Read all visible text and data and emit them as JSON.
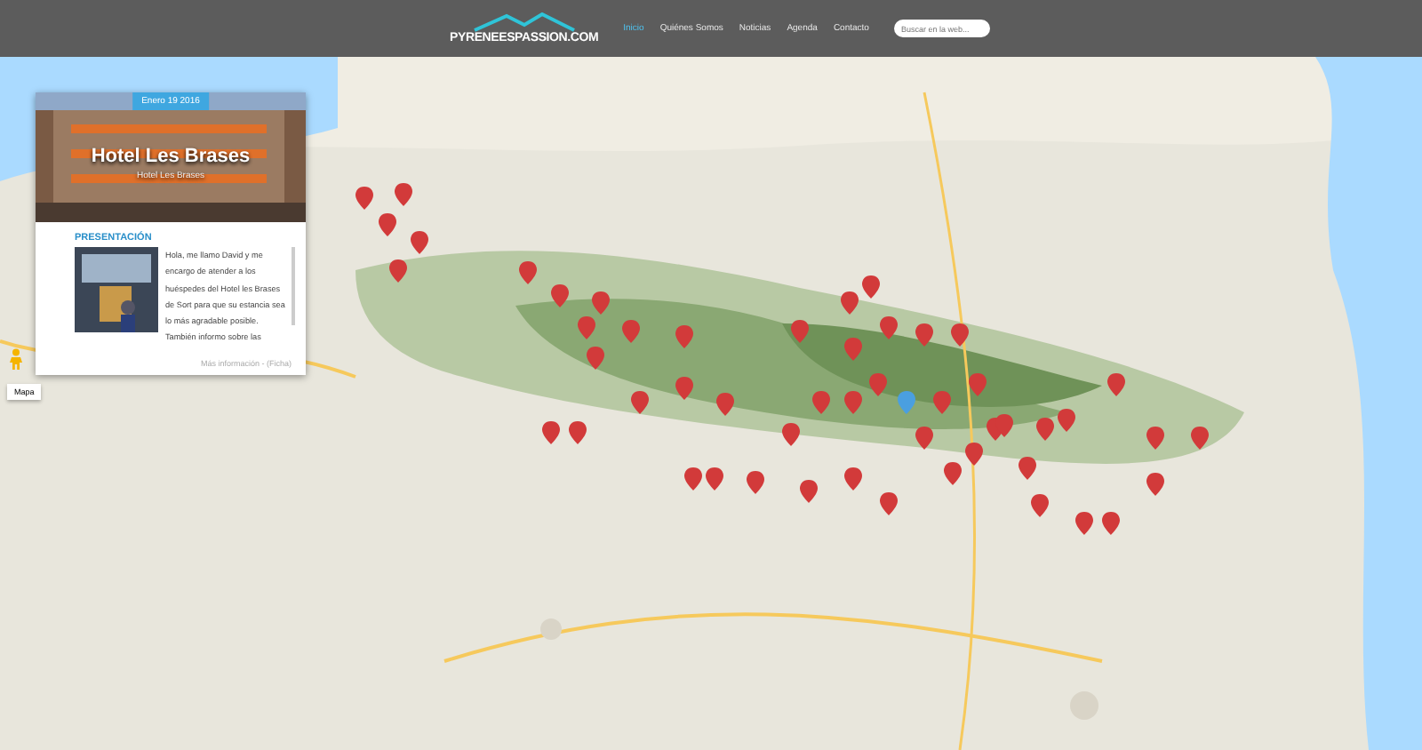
{
  "header": {
    "logo": "PYRENEESPASSION.COM",
    "nav": [
      {
        "label": "Inicio",
        "selected": true
      },
      {
        "label": "Quiénes Somos",
        "selected": false
      },
      {
        "label": "Noticias",
        "selected": false
      },
      {
        "label": "Agenda",
        "selected": false
      },
      {
        "label": "Contacto",
        "selected": false
      }
    ],
    "search": {
      "placeholder": "Buscar en la web..."
    }
  },
  "map": {
    "map_type_button": "Mapa"
  },
  "card": {
    "date": "Enero 19 2016",
    "title": "Hotel Les Brases",
    "subtitle": "Hotel Les Brases",
    "heading": "PRESENTACIÓN",
    "text": "Hola, me llamo David y me encargo de atender a los huéspedes del Hotel les Brases de Sort para que su estancia sea lo más agradable posible. También informo sobre las",
    "footer_link": "Más información - (Ficha)"
  }
}
